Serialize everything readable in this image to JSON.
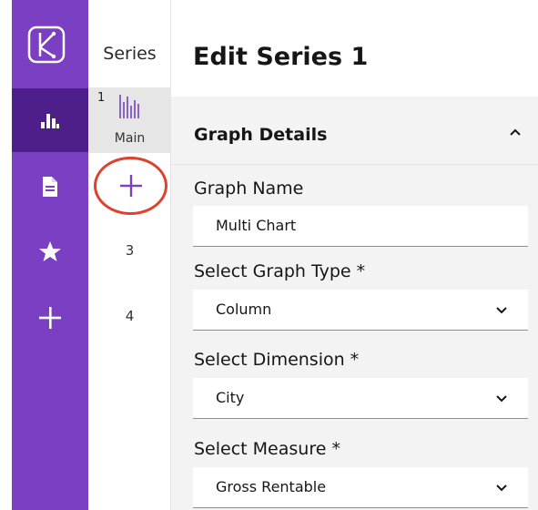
{
  "colors": {
    "rail": "#7b3fc4",
    "rail_active": "#4e1f8a",
    "accent": "#7b3fc4",
    "highlight_ring": "#e0412f",
    "panel_bg": "#f3f3f3"
  },
  "rail": {
    "logo_icon": "k-logo-icon",
    "items": [
      {
        "icon": "chart-icon",
        "active": true
      },
      {
        "icon": "document-icon",
        "active": false
      },
      {
        "icon": "star-icon",
        "active": false
      },
      {
        "icon": "plus-icon",
        "active": false
      }
    ]
  },
  "series": {
    "title": "Series",
    "items": [
      {
        "number": "1",
        "label": "Main",
        "icon": "column-chart-icon",
        "selected": true
      },
      {
        "add_icon": "plus-icon"
      },
      {
        "number": "3"
      },
      {
        "number": "4"
      }
    ]
  },
  "editor": {
    "title": "Edit Series 1",
    "section_title": "Graph Details",
    "graph_name": {
      "label": "Graph Name",
      "value": "Multi Chart"
    },
    "graph_type": {
      "label": "Select Graph Type *",
      "value": "Column"
    },
    "dimension": {
      "label": "Select Dimension  *",
      "value": "City"
    },
    "measure": {
      "label": "Select Measure  *",
      "value": "Gross Rentable"
    }
  }
}
